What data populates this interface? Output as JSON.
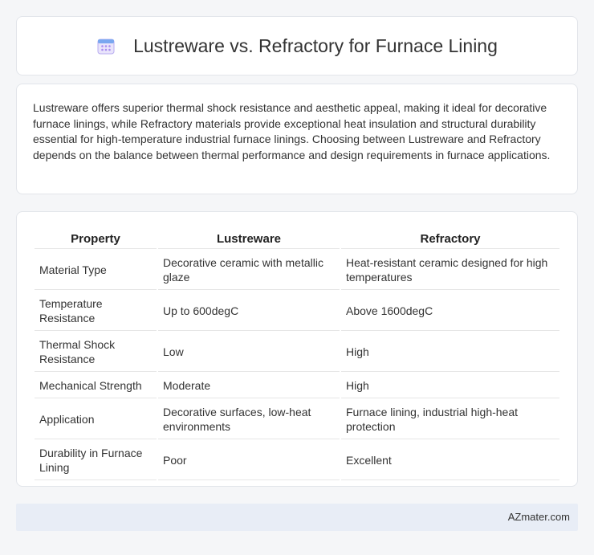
{
  "header": {
    "title": "Lustreware vs. Refractory for Furnace Lining",
    "icon": "calendar-icon"
  },
  "summary": {
    "text": "Lustreware offers superior thermal shock resistance and aesthetic appeal, making it ideal for decorative furnace linings, while Refractory materials provide exceptional heat insulation and structural durability essential for high-temperature industrial furnace linings. Choosing between Lustreware and Refractory depends on the balance between thermal performance and design requirements in furnace applications."
  },
  "table": {
    "headers": [
      "Property",
      "Lustreware",
      "Refractory"
    ],
    "rows": [
      [
        "Material Type",
        "Decorative ceramic with metallic glaze",
        "Heat-resistant ceramic designed for high temperatures"
      ],
      [
        "Temperature Resistance",
        "Up to 600degC",
        "Above 1600degC"
      ],
      [
        "Thermal Shock Resistance",
        "Low",
        "High"
      ],
      [
        "Mechanical Strength",
        "Moderate",
        "High"
      ],
      [
        "Application",
        "Decorative surfaces, low-heat environments",
        "Furnace lining, industrial high-heat protection"
      ],
      [
        "Durability in Furnace Lining",
        "Poor",
        "Excellent"
      ]
    ]
  },
  "footer": {
    "brand": "AZmater.com"
  }
}
